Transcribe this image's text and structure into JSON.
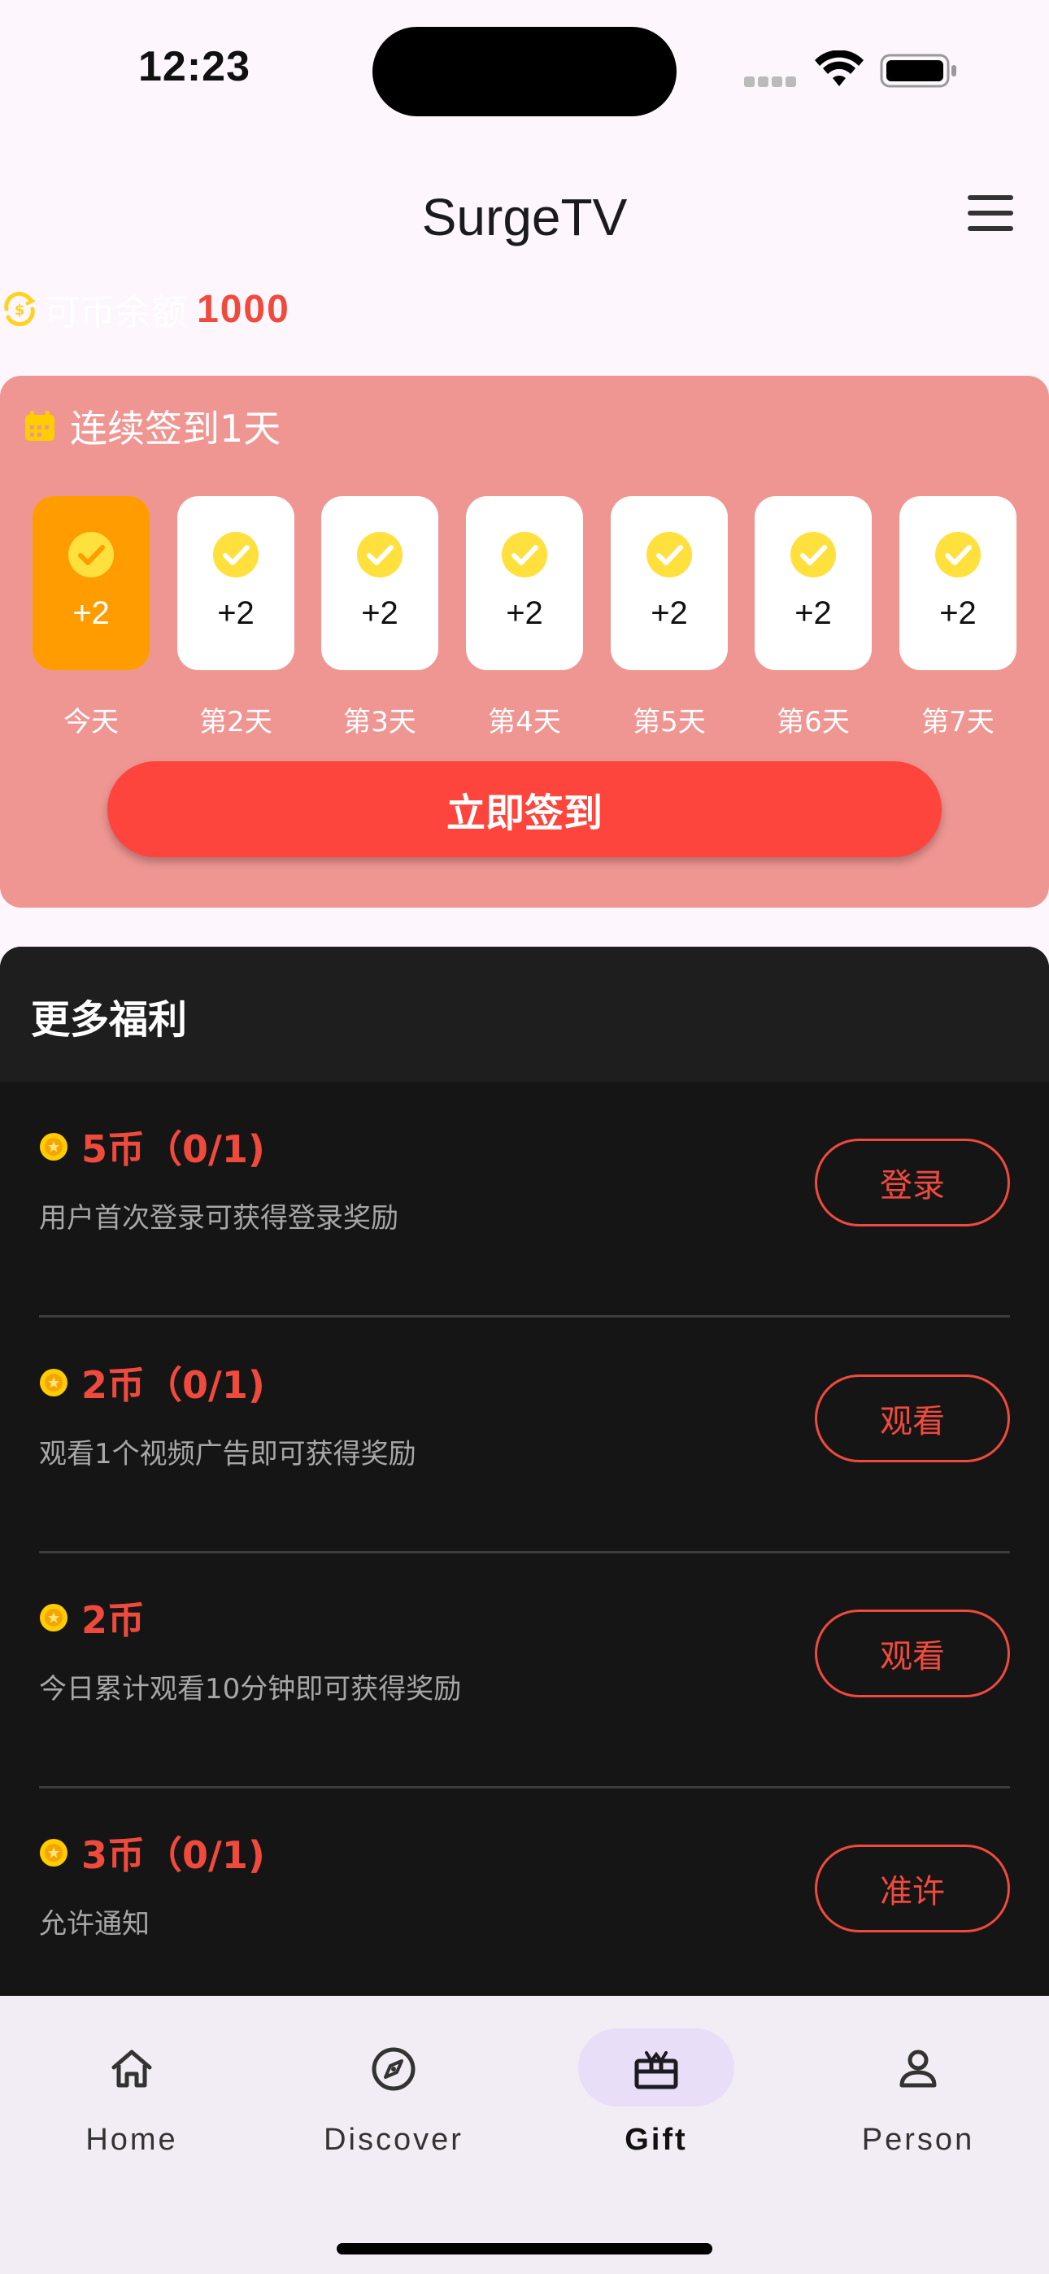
{
  "status": {
    "time": "12:23"
  },
  "app": {
    "title": "SurgeTV"
  },
  "balance": {
    "label": "可币余额",
    "value": "1000"
  },
  "checkin": {
    "streak_text": "连续签到1天",
    "days": [
      {
        "label": "今天",
        "points": "+2",
        "today": true
      },
      {
        "label": "第2天",
        "points": "+2"
      },
      {
        "label": "第3天",
        "points": "+2"
      },
      {
        "label": "第4天",
        "points": "+2"
      },
      {
        "label": "第5天",
        "points": "+2"
      },
      {
        "label": "第6天",
        "points": "+2"
      },
      {
        "label": "第7天",
        "points": "+2"
      }
    ],
    "button_label": "立即签到"
  },
  "benefits": {
    "title": "更多福利",
    "tasks": [
      {
        "reward": "5币（0/1)",
        "desc": "用户首次登录可获得登录奖励",
        "button": "登录"
      },
      {
        "reward": "2币（0/1)",
        "desc": "观看1个视频广告即可获得奖励",
        "button": "观看"
      },
      {
        "reward": "2币",
        "desc": "今日累计观看10分钟即可获得奖励",
        "button": "观看"
      },
      {
        "reward": "3币（0/1)",
        "desc": "允许通知",
        "button": "准许"
      }
    ]
  },
  "nav": {
    "items": [
      {
        "label": "Home",
        "icon": "home-icon"
      },
      {
        "label": "Discover",
        "icon": "compass-icon"
      },
      {
        "label": "Gift",
        "icon": "gift-icon",
        "active": true
      },
      {
        "label": "Person",
        "icon": "person-icon"
      }
    ]
  },
  "colors": {
    "accent": "#f04a3d",
    "card": "#ef9693",
    "today": "#ff9d00",
    "check": "#ffe03c"
  }
}
